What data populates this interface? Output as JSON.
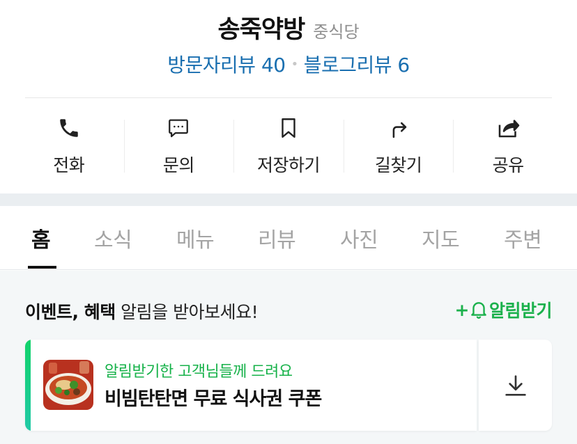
{
  "place": {
    "name": "송죽약방",
    "category": "중식당",
    "visitor_reviews": "방문자리뷰 40",
    "separator": "•",
    "blog_reviews": "블로그리뷰 6"
  },
  "actions": [
    {
      "label": "전화",
      "icon": "phone-icon"
    },
    {
      "label": "문의",
      "icon": "chat-bubble-icon"
    },
    {
      "label": "저장하기",
      "icon": "bookmark-icon"
    },
    {
      "label": "길찾기",
      "icon": "directions-icon"
    },
    {
      "label": "공유",
      "icon": "share-icon"
    }
  ],
  "tabs": [
    {
      "label": "홈",
      "active": true
    },
    {
      "label": "소식",
      "active": false
    },
    {
      "label": "메뉴",
      "active": false
    },
    {
      "label": "리뷰",
      "active": false
    },
    {
      "label": "사진",
      "active": false
    },
    {
      "label": "지도",
      "active": false
    },
    {
      "label": "주변",
      "active": false
    }
  ],
  "notice": {
    "title_bold": "이벤트, 혜택",
    "title_rest": " 알림을 받아보세요!",
    "notify_prefix": "+",
    "notify_label": "알림받기",
    "notify_icon": "bell-icon"
  },
  "coupon": {
    "subtitle": "알림받기한 고객님들께 드려요",
    "title": "비빔탄탄면 무료 식사권 쿠폰",
    "download_icon": "download-icon"
  },
  "colors": {
    "link_blue": "#1a6fb0",
    "accent_green": "#1bb14c",
    "gap_gray": "#eaeef1",
    "notice_bg": "#f4f7f8"
  }
}
